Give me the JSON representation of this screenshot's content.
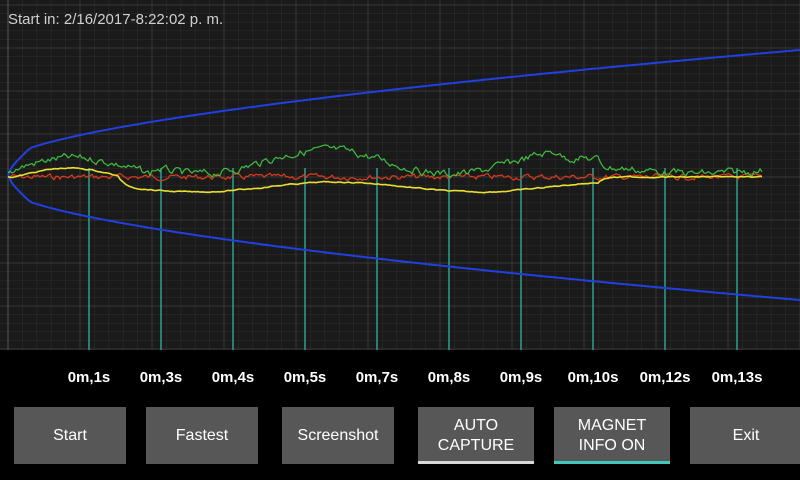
{
  "header": {
    "start_text": "Start in: 2/16/2017-8:22:02 p. m."
  },
  "plot": {
    "background": "#1a1a1a",
    "grid_color": "#3a3a3a",
    "marker_color": "#2fa99a",
    "envelope_color": "#2040e0",
    "series_colors": {
      "green": "#3fbf3f",
      "red": "#e03a1a",
      "yellow": "#e8e030"
    }
  },
  "time_ticks": [
    "0m,1s",
    "0m,3s",
    "0m,4s",
    "0m,5s",
    "0m,7s",
    "0m,8s",
    "0m,9s",
    "0m,10s",
    "0m,12s",
    "0m,13s"
  ],
  "buttons": {
    "start": "Start",
    "fastest": "Fastest",
    "screenshot": "Screenshot",
    "auto_capture": "AUTO CAPTURE",
    "magnet_info": "MAGNET INFO ON",
    "exit": "Exit"
  },
  "toggles": {
    "auto_capture_bar_color": "#d8d8d8",
    "magnet_info_bar_color": "#3fc8b8"
  }
}
